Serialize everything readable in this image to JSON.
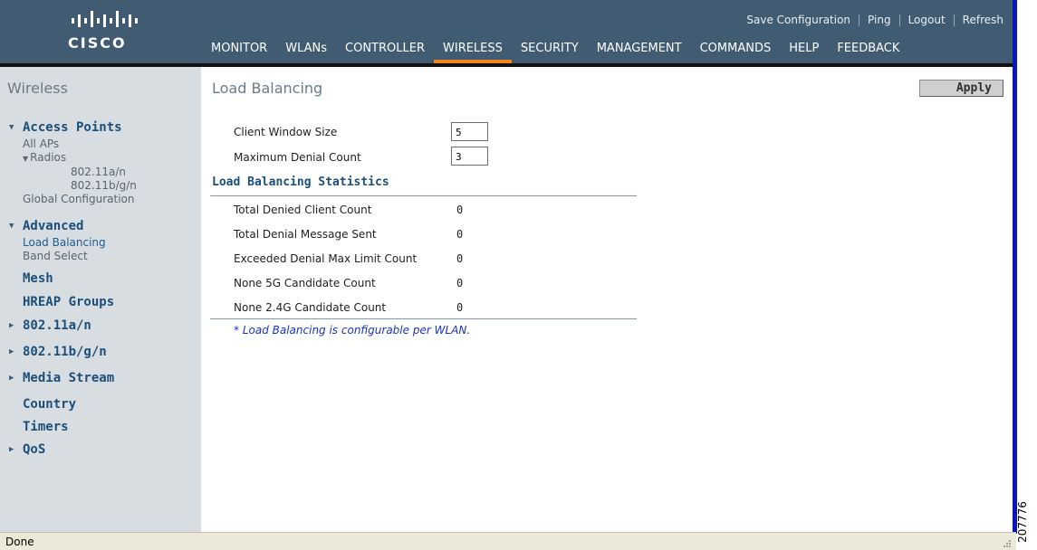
{
  "brand": {
    "name": "CISCO"
  },
  "top_links": [
    {
      "label": "Save Configuration"
    },
    {
      "label": "Ping"
    },
    {
      "label": "Logout"
    },
    {
      "label": "Refresh"
    }
  ],
  "nav": [
    {
      "label": "MONITOR"
    },
    {
      "label": "WLANs"
    },
    {
      "label": "CONTROLLER"
    },
    {
      "label": "WIRELESS",
      "active": true
    },
    {
      "label": "SECURITY"
    },
    {
      "label": "MANAGEMENT"
    },
    {
      "label": "COMMANDS"
    },
    {
      "label": "HELP"
    },
    {
      "label": "FEEDBACK"
    }
  ],
  "sidebar": {
    "title": "Wireless",
    "access_points": {
      "label": "Access Points",
      "all_aps": "All APs",
      "radios": "Radios",
      "radio_a": "802.11a/n",
      "radio_bg": "802.11b/g/n",
      "global": "Global Configuration"
    },
    "advanced": {
      "label": "Advanced",
      "load_balancing": "Load Balancing",
      "band_select": "Band Select"
    },
    "mesh": "Mesh",
    "hreap": "HREAP Groups",
    "dot11a": "802.11a/n",
    "dot11bg": "802.11b/g/n",
    "media": "Media Stream",
    "country": "Country",
    "timers": "Timers",
    "qos": "QoS"
  },
  "main": {
    "title": "Load Balancing",
    "apply": "Apply",
    "client_window_label": "Client Window Size",
    "client_window_value": "5",
    "max_denial_label": "Maximum Denial Count",
    "max_denial_value": "3",
    "stats_title": "Load Balancing Statistics",
    "stats": [
      {
        "label": "Total Denied Client Count",
        "value": "0"
      },
      {
        "label": "Total Denial Message Sent",
        "value": "0"
      },
      {
        "label": "Exceeded Denial Max Limit Count",
        "value": "0"
      },
      {
        "label": "None 5G Candidate Count",
        "value": "0"
      },
      {
        "label": "None 2.4G Candidate Count",
        "value": "0"
      }
    ],
    "note": "* Load Balancing is configurable per WLAN."
  },
  "status": {
    "text": "Done"
  },
  "watermark": "207776",
  "colors": {
    "header": "#415b72",
    "accent": "#f1861f",
    "sidebar_bg": "#d8dde1",
    "section_text": "#1b4f7a",
    "note_text": "#1732c8"
  }
}
